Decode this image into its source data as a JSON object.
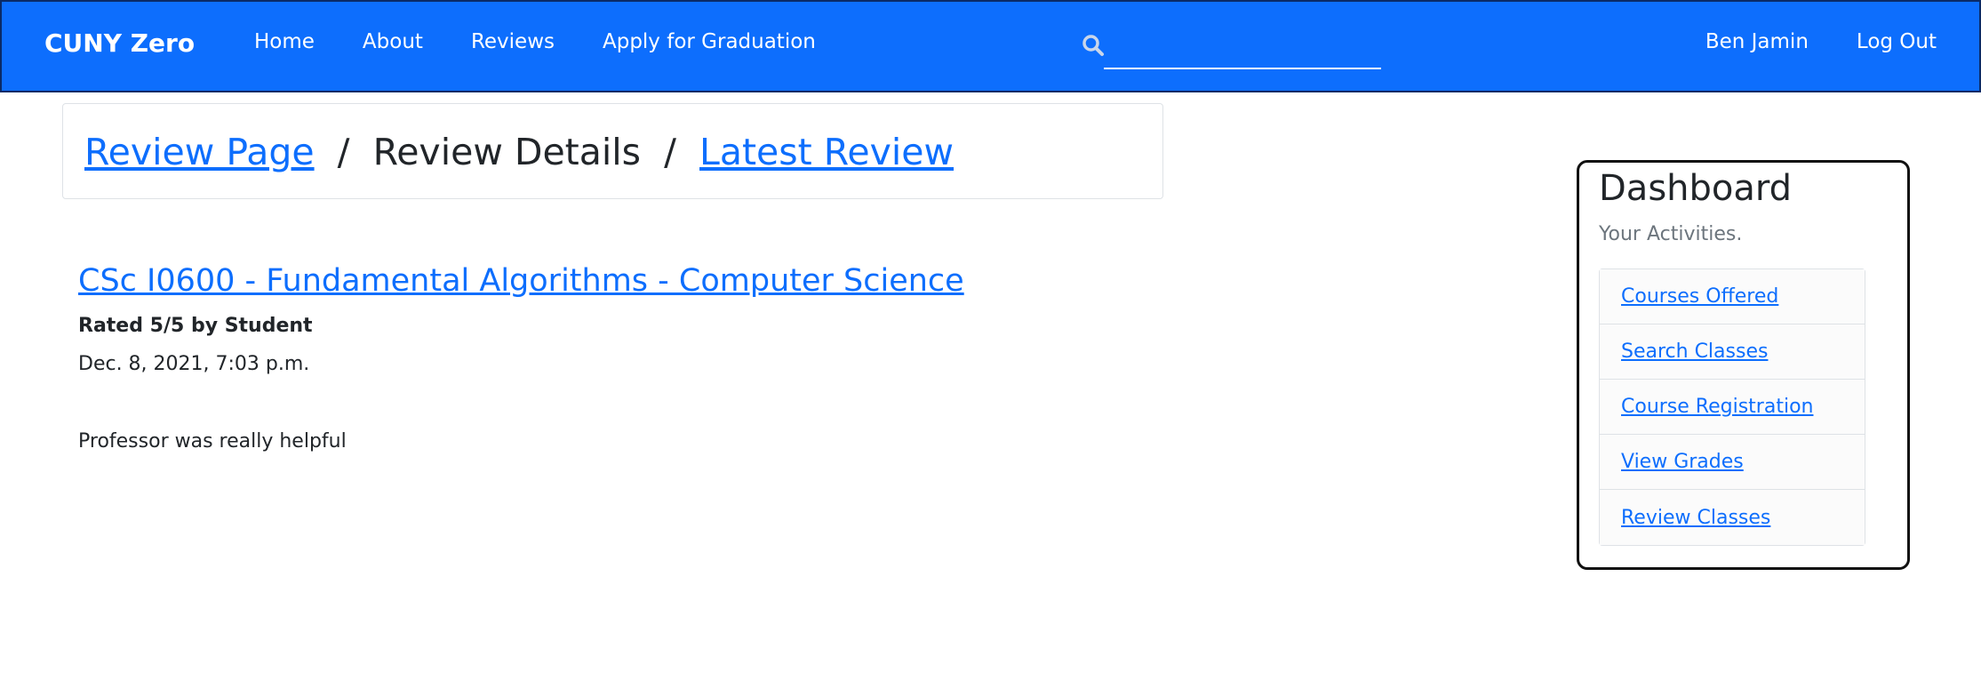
{
  "navbar": {
    "brand": "CUNY Zero",
    "links": [
      "Home",
      "About",
      "Reviews",
      "Apply for Graduation"
    ],
    "search": {
      "value": "",
      "placeholder": ""
    },
    "user_name": "Ben Jamin",
    "logout": "Log Out",
    "color": "#0d6efd"
  },
  "breadcrumb": {
    "link1": "Review Page",
    "sep1": "/",
    "current": "Review Details",
    "sep2": "/",
    "link2": "Latest Review"
  },
  "review": {
    "title": "CSc I0600 - Fundamental Algorithms - Computer Science",
    "rating": "Rated 5/5 by Student",
    "date": "Dec. 8, 2021, 7:03 p.m.",
    "body": "Professor was really helpful"
  },
  "dashboard": {
    "title": "Dashboard",
    "subtitle": "Your Activities.",
    "items": [
      "Courses Offered",
      "Search Classes",
      "Course Registration",
      "View Grades",
      "Review Classes"
    ]
  }
}
